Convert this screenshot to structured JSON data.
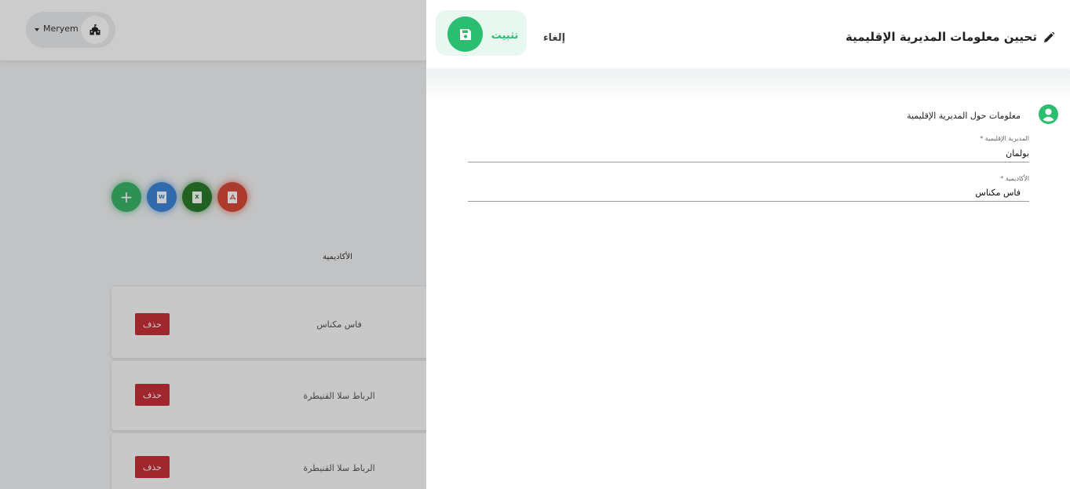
{
  "header": {
    "user_name": "Meryem",
    "user_caret_icon": "caret-down-icon",
    "user_avatar_icon": "school-icon"
  },
  "actions": {
    "add_symbol": "+",
    "word_letter": "W",
    "excel_letter": "X",
    "pdf_icon": "pdf-icon"
  },
  "table": {
    "column_header": "الأكاديمية",
    "rows": [
      {
        "academy": "فاس مكناس",
        "delete_label": "حذف"
      },
      {
        "academy": "الرباط سلا القنيطرة",
        "delete_label": "حذف"
      },
      {
        "academy": "الرباط سلا القنيطرة",
        "delete_label": "حذف"
      }
    ]
  },
  "drawer": {
    "title": "تحيين معلومات المديرية الإقليمية",
    "title_icon": "pencil-icon",
    "save_label": "تثبيت",
    "save_icon": "floppy-disk-icon",
    "cancel_label": "إلغاء",
    "section_title": "معلومات حول المديرية الإقليمية",
    "section_icon": "user-circle-icon",
    "fields": [
      {
        "label": "المديرية الإقليمية *",
        "value": "بولمان"
      },
      {
        "label": "الأكاديمية *",
        "value": "فاس مكناس"
      }
    ]
  },
  "colors": {
    "accent_green": "#2bbd70",
    "delete_red": "#c9303a",
    "word_blue": "#3f86d6",
    "excel_green": "#2a7a2a",
    "pdf_red": "#d84a3a"
  }
}
